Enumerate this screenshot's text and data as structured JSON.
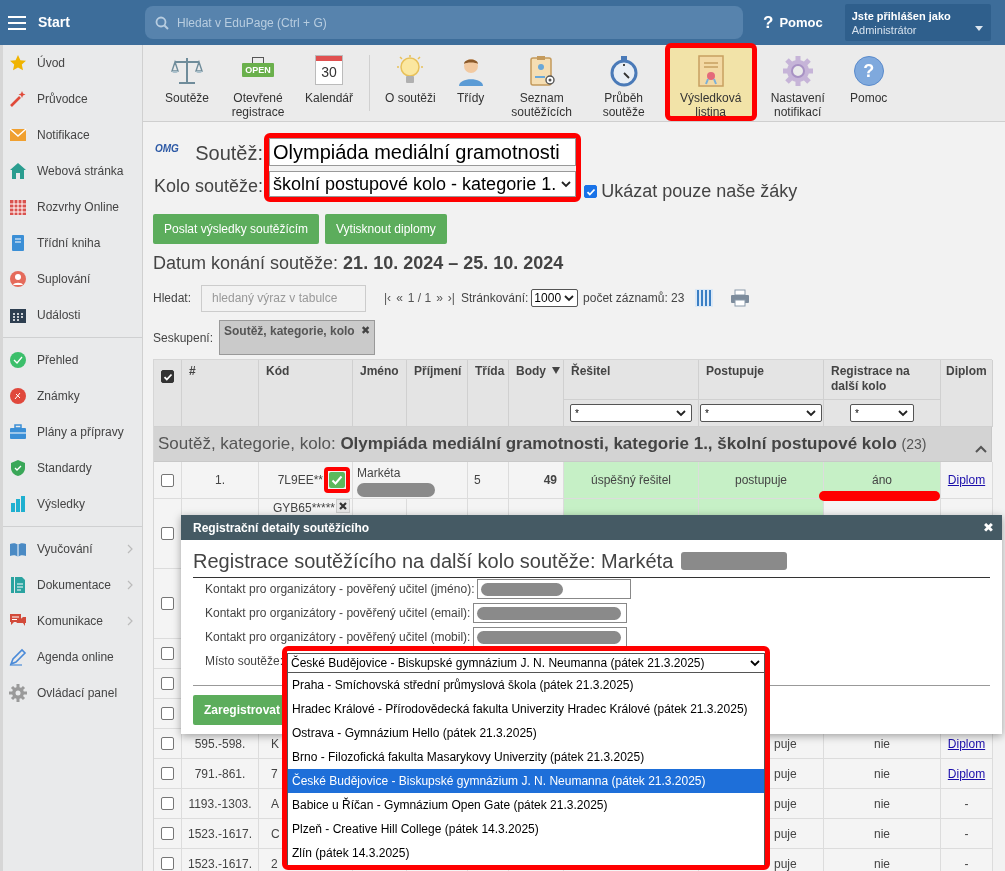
{
  "top_bar": {
    "title": "Start",
    "search": {
      "placeholder": "Hledat v EduPage (Ctrl + G)"
    },
    "help": {
      "symbol": "?",
      "label": "Pomoc"
    },
    "user": {
      "caption": "Jste přihlášen jako",
      "role": "Administrátor"
    }
  },
  "sidebar": {
    "groups": [
      [
        {
          "label": "Úvod",
          "expandable": false
        },
        {
          "label": "Průvodce",
          "expandable": false
        },
        {
          "label": "Notifikace",
          "expandable": false
        },
        {
          "label": "Webová stránka",
          "expandable": false
        },
        {
          "label": "Rozvrhy Online",
          "expandable": false
        },
        {
          "label": "Třídní kniha",
          "expandable": false
        },
        {
          "label": "Suplování",
          "expandable": false
        },
        {
          "label": "Události",
          "expandable": false
        }
      ],
      [
        {
          "label": "Přehled",
          "expandable": false
        },
        {
          "label": "Známky",
          "expandable": false
        },
        {
          "label": "Plány a přípravy",
          "expandable": false
        },
        {
          "label": "Standardy",
          "expandable": false
        },
        {
          "label": "Výsledky",
          "expandable": false
        }
      ],
      [
        {
          "label": "Vyučování",
          "expandable": true
        },
        {
          "label": "Dokumentace",
          "expandable": true
        },
        {
          "label": "Komunikace",
          "expandable": true
        },
        {
          "label": "Agenda online",
          "expandable": false
        },
        {
          "label": "Ovládací panel",
          "expandable": false
        }
      ]
    ]
  },
  "toolbar": {
    "groups": [
      [
        {
          "label": "Soutěže",
          "selected": false,
          "highlighted": false
        },
        {
          "label": "Otevřené registrace",
          "icon_text": "OPEN",
          "selected": false,
          "highlighted": false
        },
        {
          "label": "Kalendář",
          "icon_text": "30",
          "selected": false,
          "highlighted": false
        }
      ],
      [
        {
          "label": "O soutěži",
          "selected": false,
          "highlighted": false
        },
        {
          "label": "Třídy",
          "selected": false,
          "highlighted": false
        },
        {
          "label": "Seznam soutěžících",
          "selected": false,
          "highlighted": false
        },
        {
          "label": "Průběh soutěže",
          "selected": false,
          "highlighted": false
        },
        {
          "label": "Výsledková listina",
          "selected": true,
          "highlighted": true
        },
        {
          "label": "Nastavení notifikací",
          "selected": false,
          "highlighted": false
        },
        {
          "label": "Pomoc",
          "icon_text": "?",
          "selected": false,
          "highlighted": false
        }
      ]
    ]
  },
  "competition": {
    "logo": "OMG",
    "label": "Soutěž:",
    "value": "Olympiáda mediální gramotnosti",
    "highlighted": true
  },
  "round": {
    "label": "Kolo soutěže:",
    "value": "školní postupové kolo - kategorie 1."
  },
  "only_ours": {
    "label": "Ukázat pouze naše žáky",
    "checked": true
  },
  "buttons": [
    "Poslat výsledky soutěžícím",
    "Vytisknout diplomy"
  ],
  "date": {
    "label": "Datum konání soutěže:",
    "value": "21. 10. 2024 – 25. 10. 2024"
  },
  "search": {
    "label": "Hledat:",
    "placeholder": "hledaný výraz v tabulce"
  },
  "pager": {
    "first": "|‹",
    "prev": "«",
    "page": "1 / 1",
    "next": "»",
    "last": "›|",
    "page_size_label": "Stránkování:",
    "page_size": "1000",
    "count": "počet záznamů: 23"
  },
  "grouping": {
    "label": "Seskupení:",
    "chip": "Soutěž, kategorie, kolo",
    "remove": "✖"
  },
  "table": {
    "select_all": {
      "checked": true
    },
    "columns": [
      {
        "label": "#",
        "sorted": false
      },
      {
        "label": "Kód",
        "sorted": false
      },
      {
        "label": "Jméno",
        "sorted": false
      },
      {
        "label": "Příjmení",
        "sorted": false
      },
      {
        "label": "Třída",
        "sorted": false
      },
      {
        "label": "Body",
        "sorted": true
      },
      {
        "label": "Řešitel",
        "sorted": false,
        "filter": "*"
      },
      {
        "label": "Postupuje",
        "sorted": false,
        "filter": "*"
      },
      {
        "label": "Registrace na další kolo",
        "sorted": false,
        "filter": "*"
      },
      {
        "label": "Diplom",
        "sorted": false
      }
    ],
    "group": {
      "label": "Soutěž, kategorie, kolo:",
      "value": "Olympiáda mediální gramotnosti, kategorie 1., školní postupové kolo",
      "count": "(23)",
      "expanded": true
    },
    "rows": [
      {
        "checked": false,
        "rank": "1.",
        "code": "7L9EE**",
        "registered": true,
        "status_highlighted": true,
        "first_name": "Markéta",
        "class": "5",
        "points": "49",
        "solver": "úspěšný řešitel",
        "advances": "postupuje",
        "registration": "áno",
        "registration_underlined": true,
        "diploma": "Diplom",
        "success": true
      },
      {
        "checked": false,
        "code": "GYB65*****",
        "registered": false,
        "status_highlighted": false,
        "success": true
      },
      {
        "checked": false
      },
      {
        "checked": false
      },
      {
        "checked": false
      },
      {
        "checked": false
      },
      {
        "checked": false,
        "rank": "595.-598.",
        "code": "K",
        "advances": "puje",
        "registration": "nie",
        "diploma": "Diplom"
      },
      {
        "checked": false,
        "rank": "791.-861.",
        "code": "7",
        "advances": "puje",
        "registration": "nie",
        "diploma": "Diplom"
      },
      {
        "checked": false,
        "rank": "1193.-1303.",
        "code": "A",
        "advances": "puje",
        "registration": "nie",
        "diploma": "-"
      },
      {
        "checked": false,
        "rank": "1523.-1617.",
        "code": "C",
        "advances": "puje",
        "registration": "nie",
        "diploma": "-"
      },
      {
        "checked": false,
        "rank": "1523.-1617.",
        "code": "2",
        "advances": "puje",
        "registration": "nie",
        "diploma": "-"
      }
    ]
  },
  "dialog": {
    "title": "Registrační detaily soutěžícího",
    "close": "✖",
    "heading": "Registrace soutěžícího na další kolo soutěže: Markéta",
    "fields": [
      {
        "label": "Kontakt pro organizátory - pověřený učitel (jméno):"
      },
      {
        "label": "Kontakt pro organizátory - pověřený učitel (email):"
      },
      {
        "label": "Kontakt pro organizátory - pověřený učitel (mobil):"
      }
    ],
    "venue": {
      "label": "Místo soutěže:",
      "value": "České Budějovice - Biskupské gymnázium J. N. Neumanna (pátek 21.3.2025)",
      "expanded": true,
      "highlighted": true,
      "options": [
        {
          "label": "Praha - Smíchovská střední průmyslová škola (pátek 21.3.2025)",
          "selected": false
        },
        {
          "label": "Hradec Králové - Přírodovědecká fakulta Univerzity Hradec Králové (pátek 21.3.2025)",
          "selected": false
        },
        {
          "label": "Ostrava - Gymnázium Hello (pátek 21.3.2025)",
          "selected": false
        },
        {
          "label": "Brno - Filozofická fakulta Masarykovy Univerzity (pátek 21.3.2025)",
          "selected": false
        },
        {
          "label": "České Budějovice - Biskupské gymnázium J. N. Neumanna (pátek 21.3.2025)",
          "selected": true
        },
        {
          "label": "Babice u Říčan - Gymnázium Open Gate (pátek 21.3.2025)",
          "selected": false
        },
        {
          "label": "Plzeň - Creative Hill College (pátek 14.3.2025)",
          "selected": false
        },
        {
          "label": "Zlín (pátek 14.3.2025)",
          "selected": false
        }
      ]
    },
    "submit": "Zaregistrovat"
  }
}
